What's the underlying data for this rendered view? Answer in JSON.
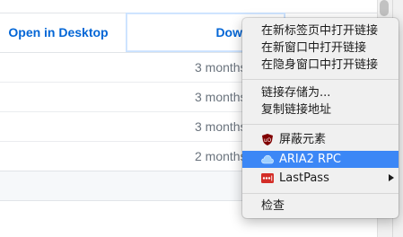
{
  "repo_actions": {
    "open_desktop_label": "Open in Desktop",
    "download_zip_label": "Download ZIP"
  },
  "file_rows": [
    {
      "age": "3 months"
    },
    {
      "age": "3 months"
    },
    {
      "age": "3 months"
    },
    {
      "age": "2 months"
    }
  ],
  "context_menu": {
    "open_new_tab": "在新标签页中打开链接",
    "open_new_window": "在新窗口中打开链接",
    "open_incognito": "在隐身窗口中打开链接",
    "save_link_as": "链接存储为...",
    "copy_link": "复制链接地址",
    "ublock_item": "屏蔽元素",
    "aria2_item": "ARIA2 RPC",
    "lastpass_item": "LastPass",
    "inspect": "检查",
    "highlight_color": "#3c87f6",
    "icons": [
      "ublock-shield-icon",
      "cloud-icon",
      "lastpass-icon",
      "submenu-arrow-icon"
    ]
  }
}
